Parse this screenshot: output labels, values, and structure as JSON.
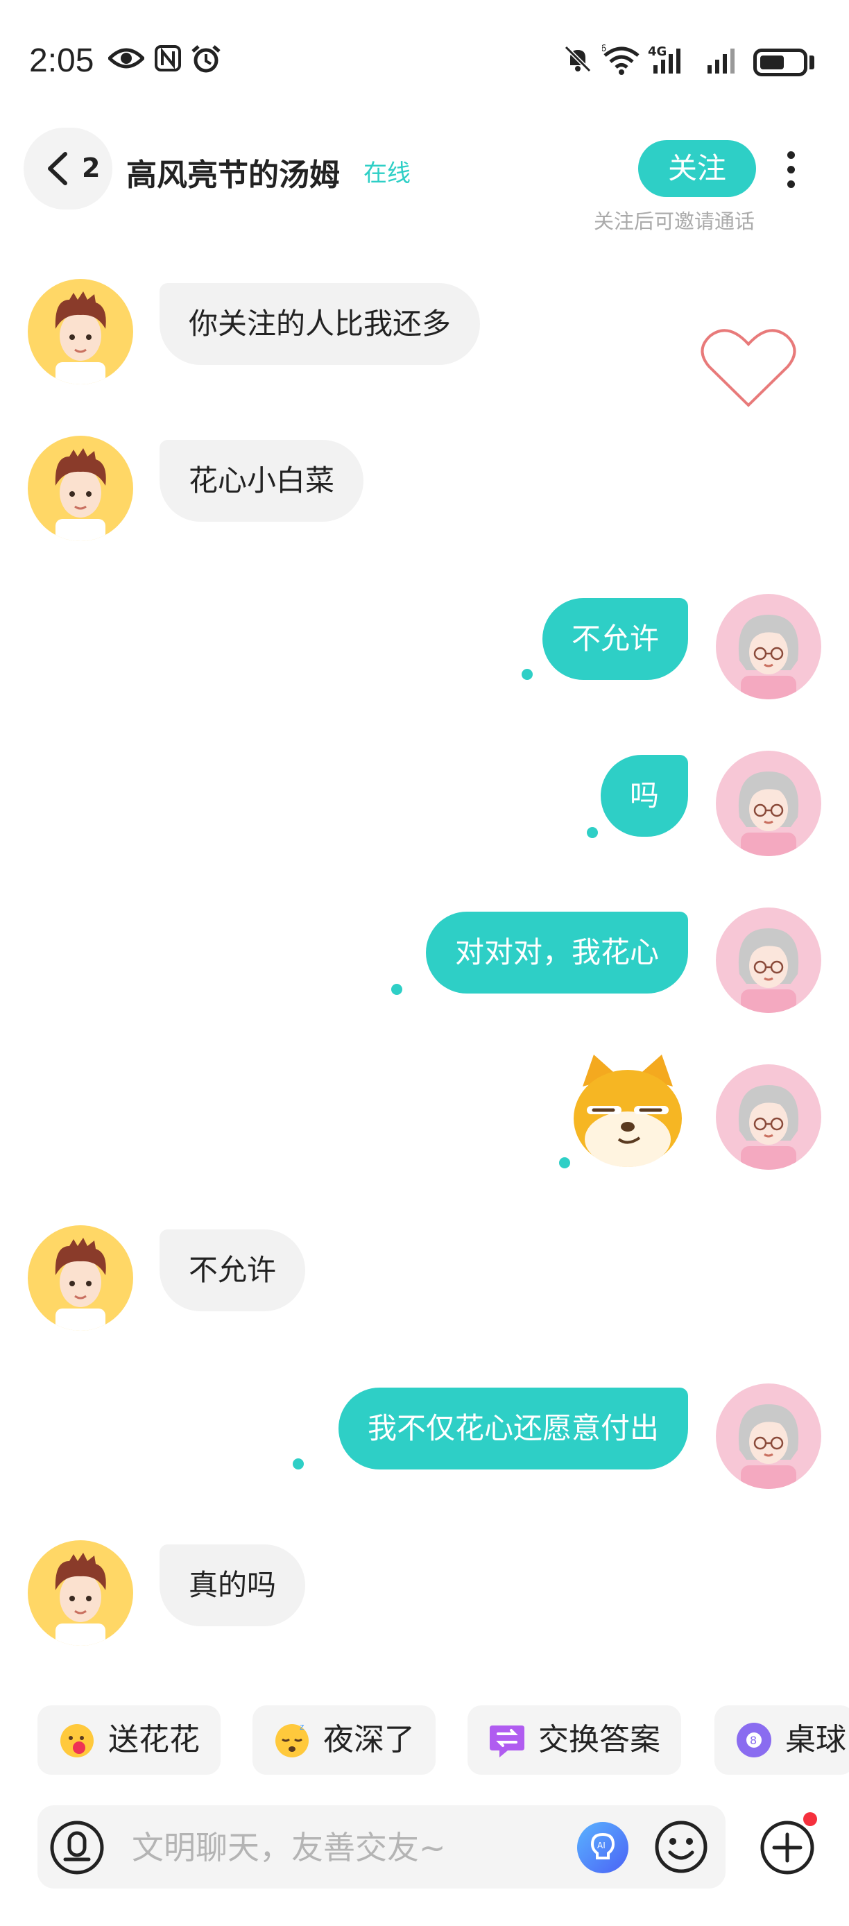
{
  "status_bar": {
    "time": "2:05",
    "network": "4G",
    "wifi_badge": "6",
    "battery_percent": 50,
    "icons": [
      "eye-icon",
      "nfc-icon",
      "alarm-icon",
      "mute-icon",
      "wifi-icon",
      "signal-icon",
      "signal-icon",
      "battery-icon"
    ]
  },
  "header": {
    "back_count": "2",
    "title": "高风亮节的汤姆",
    "status": "在线",
    "follow_label": "关注",
    "follow_hint": "关注后可邀请通话"
  },
  "colors": {
    "accent": "#2ecfc6",
    "incoming_bubble": "#f2f2f2",
    "heart": "#e87a7a"
  },
  "messages": [
    {
      "side": "in",
      "text": "你关注的人比我还多"
    },
    {
      "side": "in",
      "text": "花心小白菜"
    },
    {
      "side": "out",
      "text": "不允许"
    },
    {
      "side": "out",
      "text": "吗"
    },
    {
      "side": "out",
      "text": "对对对，我花心"
    },
    {
      "side": "out",
      "sticker": "shiba-dog-sticker"
    },
    {
      "side": "in",
      "text": "不允许"
    },
    {
      "side": "out",
      "text": "我不仅花心还愿意付出"
    },
    {
      "side": "in",
      "text": "真的吗"
    }
  ],
  "quick_replies": [
    {
      "label": "送花花",
      "icon": "flower-face-icon"
    },
    {
      "label": "夜深了",
      "icon": "sleepy-face-icon"
    },
    {
      "label": "交换答案",
      "icon": "exchange-icon"
    },
    {
      "label": "桌球",
      "icon": "billiard-ball-icon"
    }
  ],
  "input": {
    "placeholder": "文明聊天，友善交友~"
  }
}
